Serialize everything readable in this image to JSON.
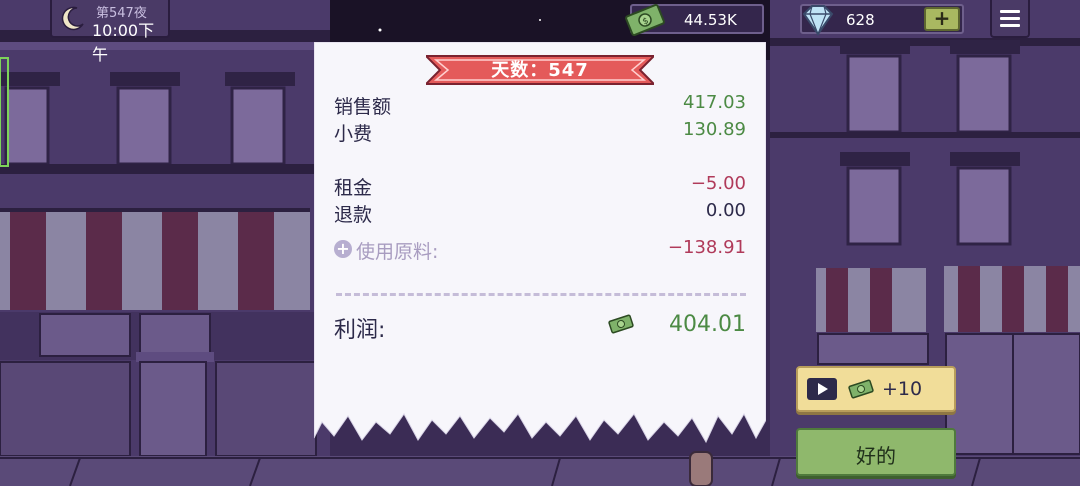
{
  "hud": {
    "night_label": "第547夜",
    "time": "10:00下午",
    "money": "44.53K",
    "gems": "628",
    "gem_plus": "+",
    "icons": [
      "moon-icon",
      "cash-icon",
      "diamond-icon",
      "menu-icon"
    ]
  },
  "receipt": {
    "day_banner": "天数：547",
    "rows": [
      {
        "label": "销售额",
        "value": "417.03"
      },
      {
        "label": "小费",
        "value": "130.89"
      },
      {
        "label": "租金",
        "value": "−5.00"
      },
      {
        "label": "退款",
        "value": "0.00"
      },
      {
        "label": "使用原料:",
        "value": "−138.91"
      }
    ],
    "profit_label": "利润:",
    "profit_value": "404.01"
  },
  "buttons": {
    "ad_reward": "+10",
    "ok_label": "好的"
  },
  "colors": {
    "positive": "#4c8a44",
    "negative": "#b03a5a",
    "banner_red": "#e45a5a",
    "ok_green": "#8fb86c"
  }
}
